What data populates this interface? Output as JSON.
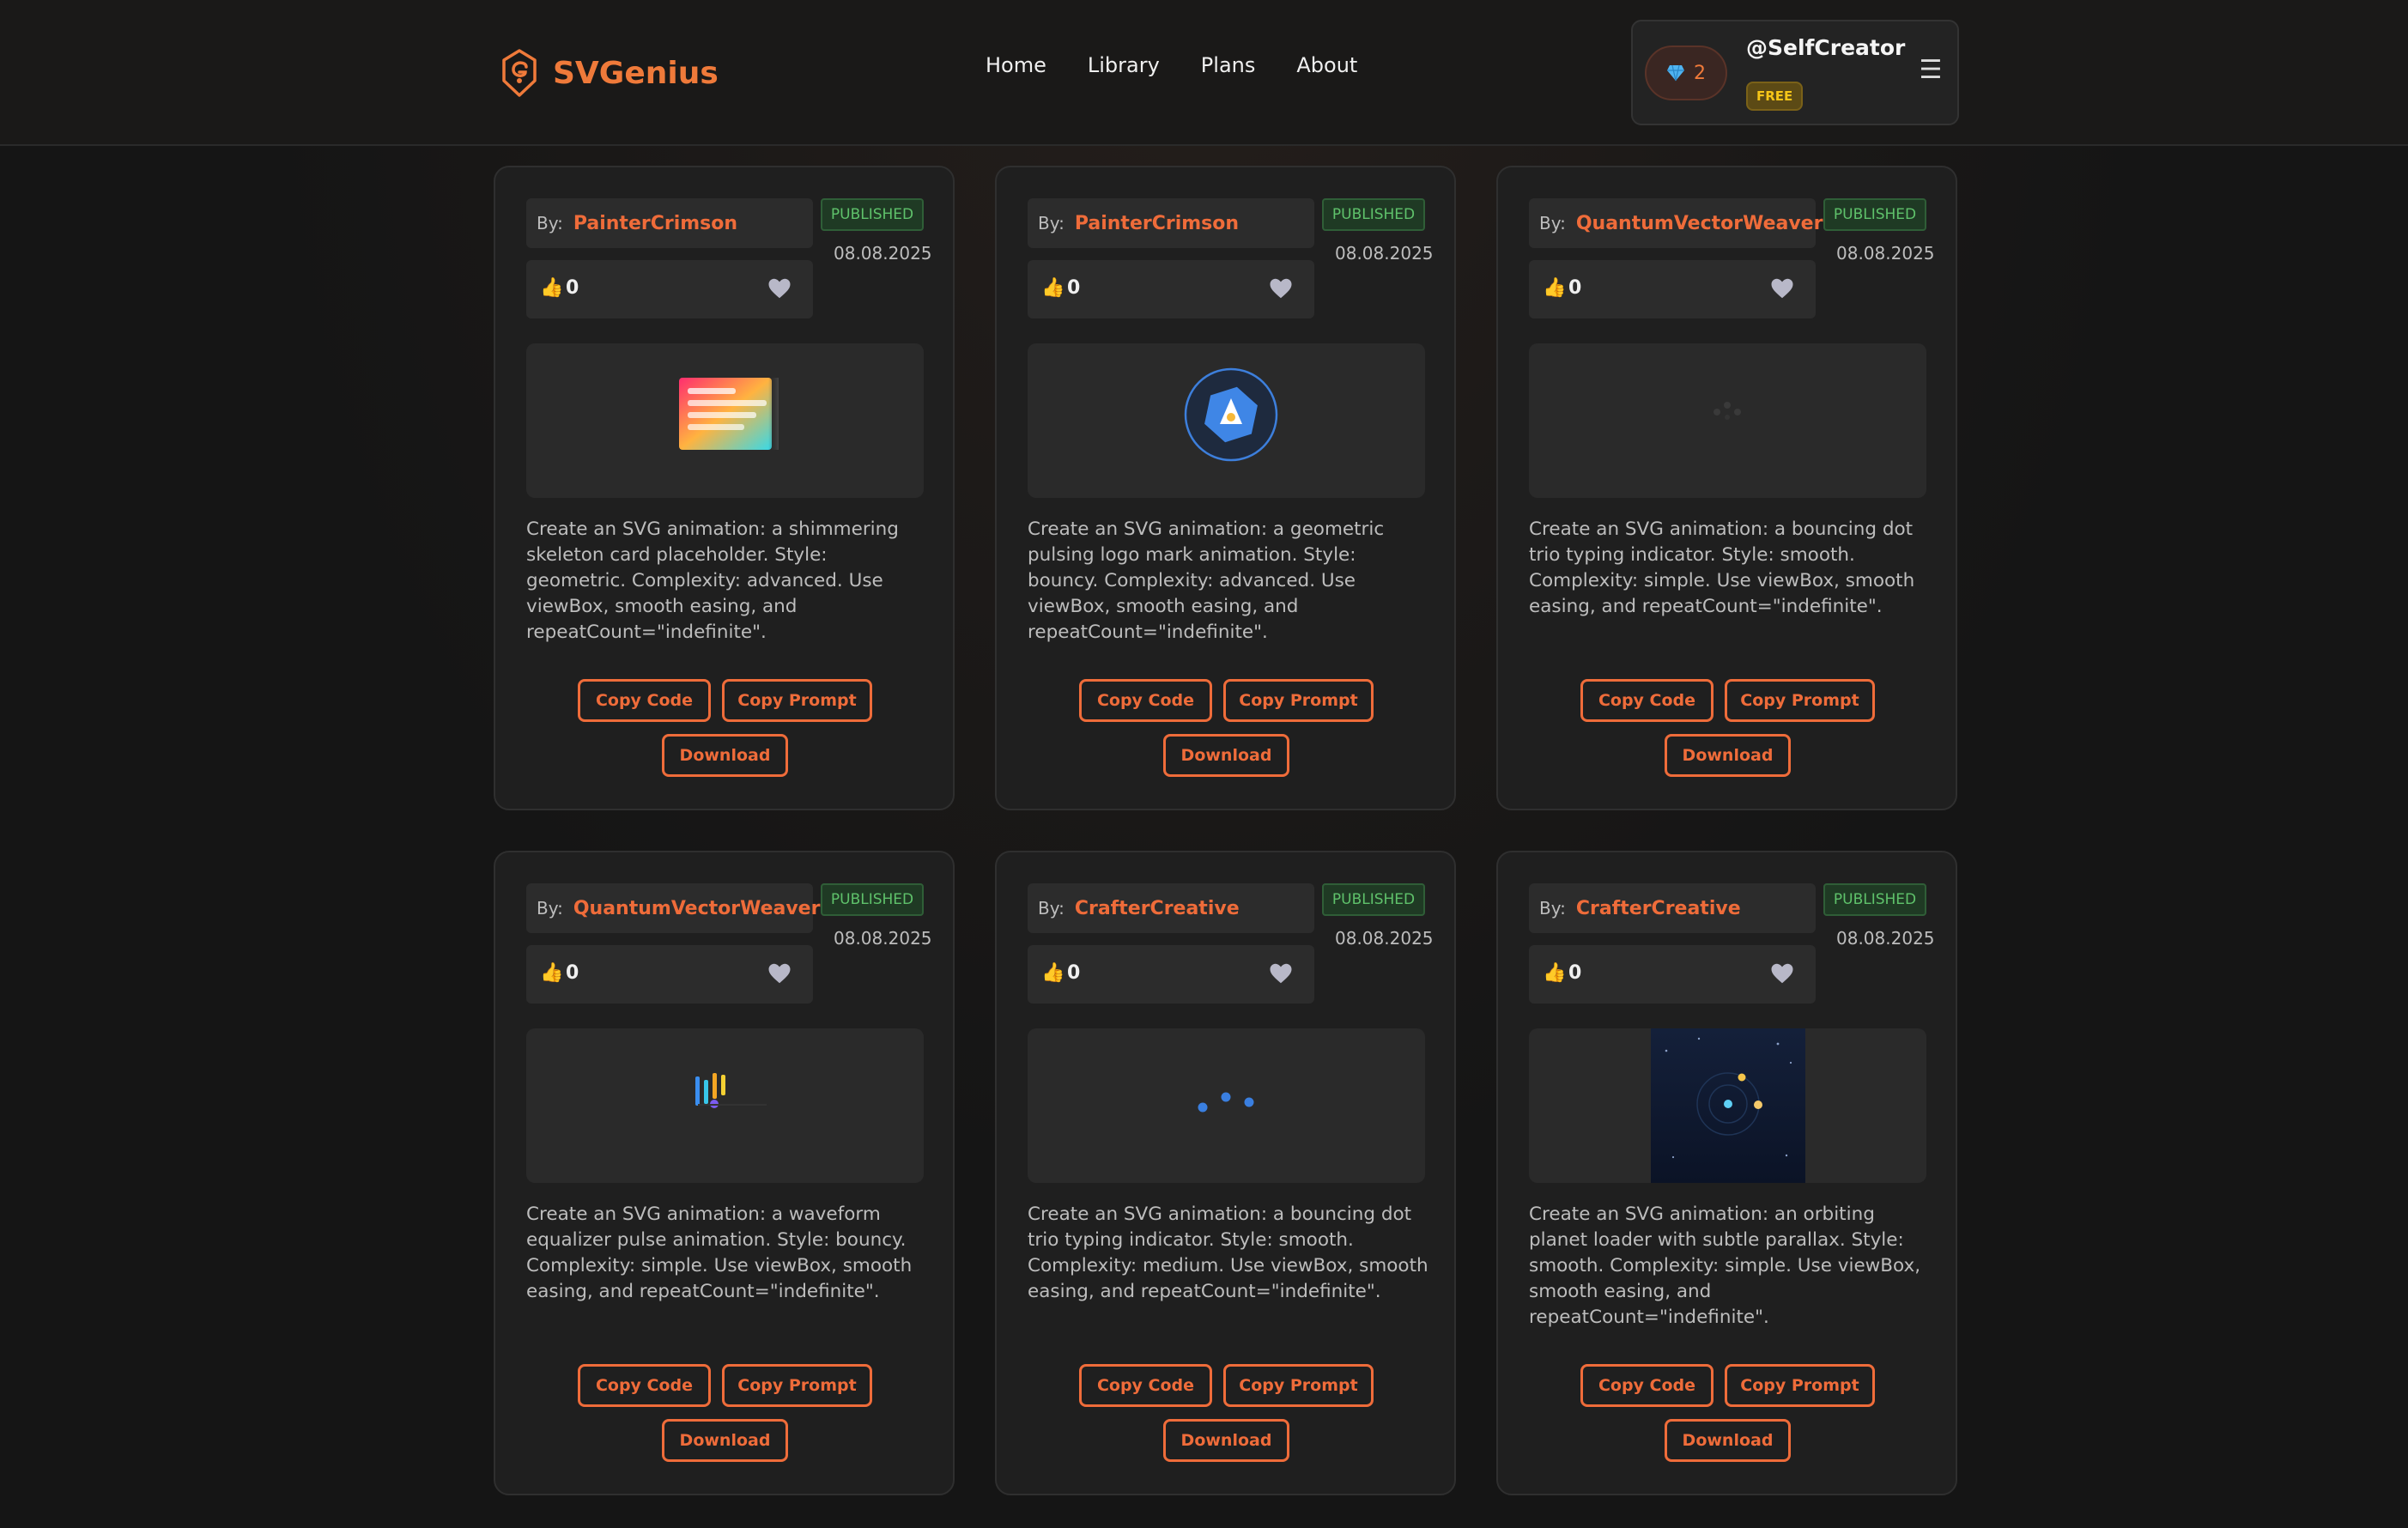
{
  "app": {
    "name": "SVGenius",
    "accent": "#ef7a3a"
  },
  "nav": [
    "Home",
    "Library",
    "Plans",
    "About"
  ],
  "user": {
    "gems": "2",
    "username": "@SelfCreator",
    "plan": "FREE"
  },
  "card_labels": {
    "by": "By:",
    "copy_code": "Copy Code",
    "copy_prompt": "Copy Prompt",
    "download": "Download"
  },
  "cards": [
    {
      "author": "PainterCrimson",
      "status": "PUBLISHED",
      "date": "08.08.2025",
      "likes": "0",
      "preview": "skeleton-card",
      "prompt": "Create an SVG animation: a shimmering skeleton card placeholder. Style: geometric. Complexity: advanced. Use viewBox, smooth easing, and repeatCount=\"indefinite\"."
    },
    {
      "author": "PainterCrimson",
      "status": "PUBLISHED",
      "date": "08.08.2025",
      "likes": "0",
      "preview": "logo-mark",
      "prompt": "Create an SVG animation: a geometric pulsing logo mark animation. Style: bouncy. Complexity: advanced. Use viewBox, smooth easing, and repeatCount=\"indefinite\"."
    },
    {
      "author": "QuantumVectorWeaver",
      "status": "PUBLISHED",
      "date": "08.08.2025",
      "likes": "0",
      "preview": "dot-trio-faint",
      "prompt": "Create an SVG animation: a bouncing dot trio typing indicator. Style: smooth. Complexity: simple. Use viewBox, smooth easing, and repeatCount=\"indefinite\"."
    },
    {
      "author": "QuantumVectorWeaver",
      "status": "PUBLISHED",
      "date": "08.08.2025",
      "likes": "0",
      "preview": "equalizer",
      "prompt": "Create an SVG animation: a waveform equalizer pulse animation. Style: bouncy. Complexity: simple. Use viewBox, smooth easing, and repeatCount=\"indefinite\"."
    },
    {
      "author": "CrafterCreative",
      "status": "PUBLISHED",
      "date": "08.08.2025",
      "likes": "0",
      "preview": "dot-trio-blue",
      "prompt": "Create an SVG animation: a bouncing dot trio typing indicator. Style: smooth. Complexity: medium. Use viewBox, smooth easing, and repeatCount=\"indefinite\"."
    },
    {
      "author": "CrafterCreative",
      "status": "PUBLISHED",
      "date": "08.08.2025",
      "likes": "0",
      "preview": "orbit-loader",
      "prompt": "Create an SVG animation: an orbiting planet loader with subtle parallax. Style: smooth. Complexity: simple. Use viewBox, smooth easing, and repeatCount=\"indefinite\"."
    }
  ]
}
